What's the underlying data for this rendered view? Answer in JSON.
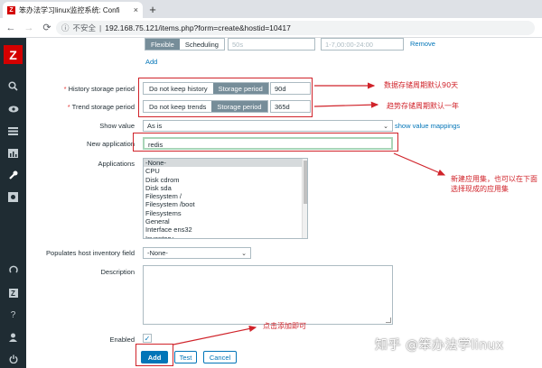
{
  "browser": {
    "tab_title": "笨办法学习linux监控系统: Confi",
    "tab_close": "×",
    "new_tab": "+",
    "favicon": "Z",
    "insecure_label": "不安全",
    "url": "192.168.75.121/items.php?form=create&hostid=10417"
  },
  "sidebar": {
    "logo": "Z",
    "icons": [
      "search-icon",
      "eye-icon",
      "list-icon",
      "chart-icon",
      "wrench-icon",
      "cog-icon",
      "support-icon",
      "share-icon",
      "help-icon",
      "user-icon",
      "power-icon"
    ]
  },
  "interval_row": {
    "mode_flexible": "Flexible",
    "mode_scheduling": "Scheduling",
    "interval_placeholder": "50s",
    "period_placeholder": "1-7,00:00-24:00",
    "remove_label": "Remove",
    "add_label": "Add"
  },
  "history": {
    "label": "History storage period",
    "opt_no_keep": "Do not keep history",
    "opt_storage": "Storage period",
    "value": "90d"
  },
  "trend": {
    "label": "Trend storage period",
    "opt_no_keep": "Do not keep trends",
    "opt_storage": "Storage period",
    "value": "365d"
  },
  "show_value": {
    "label": "Show value",
    "selected": "As is",
    "mappings_link": "show value mappings"
  },
  "new_application": {
    "label": "New application",
    "value": "redis"
  },
  "applications": {
    "label": "Applications",
    "options": [
      "-None-",
      "CPU",
      "Disk cdrom",
      "Disk sda",
      "Filesystem /",
      "Filesystem /boot",
      "Filesystems",
      "General",
      "Interface ens32",
      "Inventory"
    ]
  },
  "inventory": {
    "label": "Populates host inventory field",
    "selected": "-None-"
  },
  "description": {
    "label": "Description"
  },
  "enabled": {
    "label": "Enabled",
    "check": "✓"
  },
  "buttons": {
    "add": "Add",
    "test": "Test",
    "cancel": "Cancel"
  },
  "annotations": {
    "history_note": "数据存储周期默认90天",
    "trend_note": "趋势存储周期默认一年",
    "application_note": "新建应用集，也可以在下面选择现成的应用集",
    "add_note": "点击添加即可",
    "watermark": "知乎 @笨办法学linux"
  },
  "colors": {
    "annotation_red": "#d0232a",
    "zabbix_blue": "#0275b8",
    "sidebar_dark": "#1f2c33",
    "logo_red": "#d40000"
  }
}
